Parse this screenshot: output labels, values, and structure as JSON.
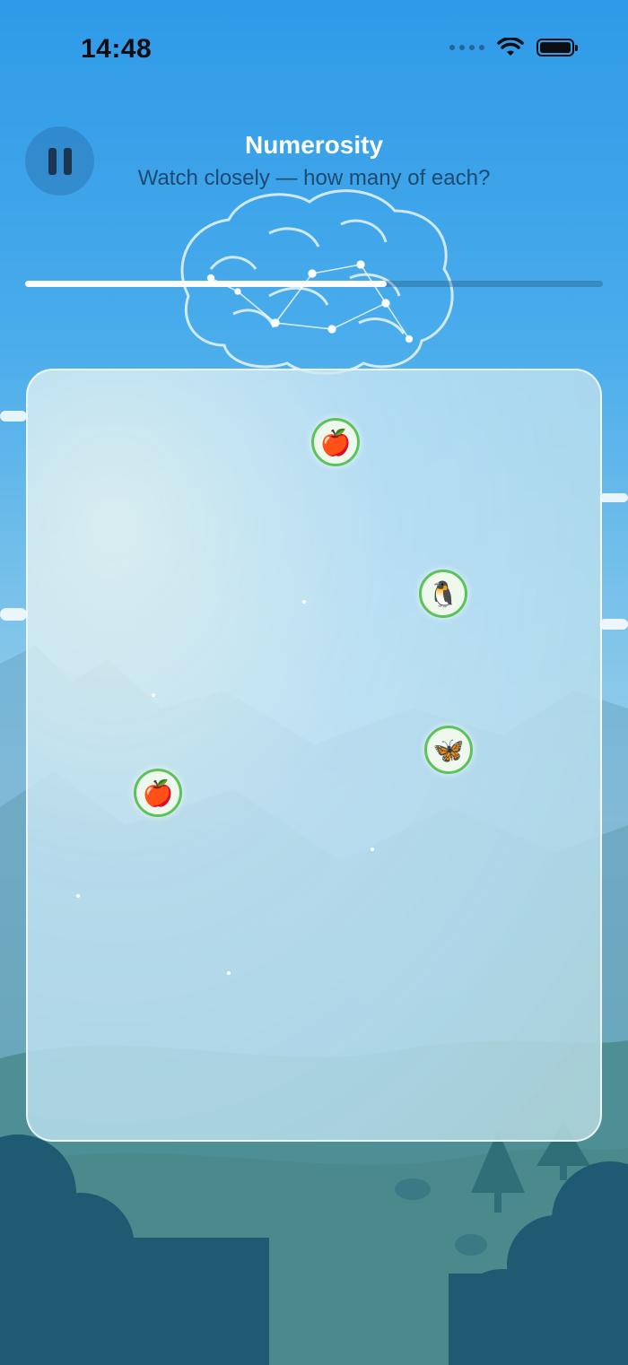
{
  "status_bar": {
    "time": "14:48",
    "icons": [
      "signal-dots-icon",
      "wifi-icon",
      "battery-icon"
    ]
  },
  "header": {
    "title": "Numerosity",
    "subtitle": "Watch closely — how many of each?",
    "pause_icon": "pause-icon"
  },
  "progress": {
    "fraction": 0.625
  },
  "play_area": {
    "items": [
      {
        "name": "apple",
        "glyph": "🍎"
      },
      {
        "name": "penguin",
        "glyph": "🐧"
      },
      {
        "name": "butterfly",
        "glyph": "🦋"
      },
      {
        "name": "apple",
        "glyph": "🍎"
      }
    ]
  },
  "colors": {
    "token_border": "#5cc25a",
    "token_fill": "#eef8ec",
    "progress_fill": "#ffffff"
  }
}
